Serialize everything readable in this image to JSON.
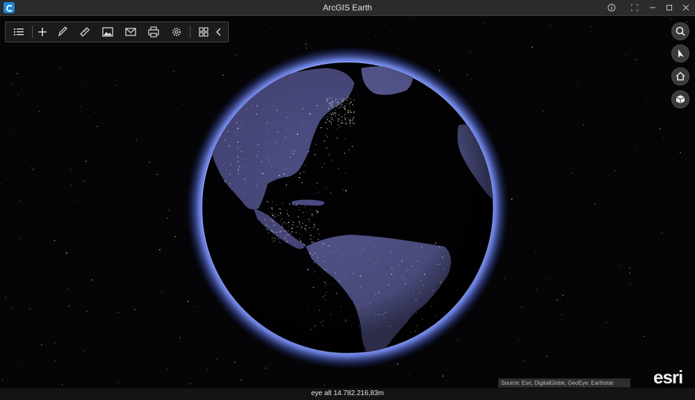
{
  "window": {
    "title": "ArcGIS Earth",
    "buttons": [
      "info-icon",
      "fullscreen-icon",
      "minimize-icon",
      "maximize-icon",
      "close-icon"
    ]
  },
  "toolbar": {
    "items": [
      "layers-list-icon",
      "add-icon",
      "draw-icon",
      "measure-icon",
      "image-icon",
      "mail-icon",
      "print-icon",
      "settings-icon",
      "grid-icon",
      "collapse-chevron-icon"
    ]
  },
  "navigation": {
    "items": [
      "search-icon",
      "navigate-arrow-icon",
      "home-icon",
      "3d-cube-icon"
    ]
  },
  "status": {
    "eye_alt": "eye alt 14.782.216,83m",
    "source": "Source: Esri, DigitalGlobe, GeoEye, Earthstar",
    "logo": "esri"
  }
}
